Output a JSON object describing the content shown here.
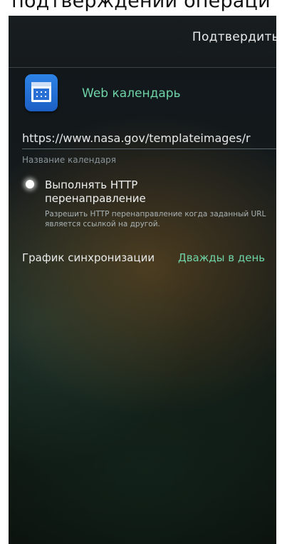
{
  "top_caption": "подтверждении операци",
  "actionbar": {
    "confirm_label": "Подтвердить"
  },
  "app": {
    "name": "Web календарь",
    "icon": "calendar-icon"
  },
  "url": {
    "value": "https://www.nasa.gov/templateimages/r",
    "hint": "Название календаря"
  },
  "http_redirect": {
    "checked": true,
    "title": "Выполнять HTTP перенаправление",
    "description": "Разрешить HTTP перенаправление когда заданный URL является ссылкой на другой."
  },
  "sync": {
    "label": "График синхронизации",
    "value": "Дважды в день"
  },
  "colors": {
    "accent": "#6fd3a8",
    "icon_blue": "#2d83e6"
  }
}
